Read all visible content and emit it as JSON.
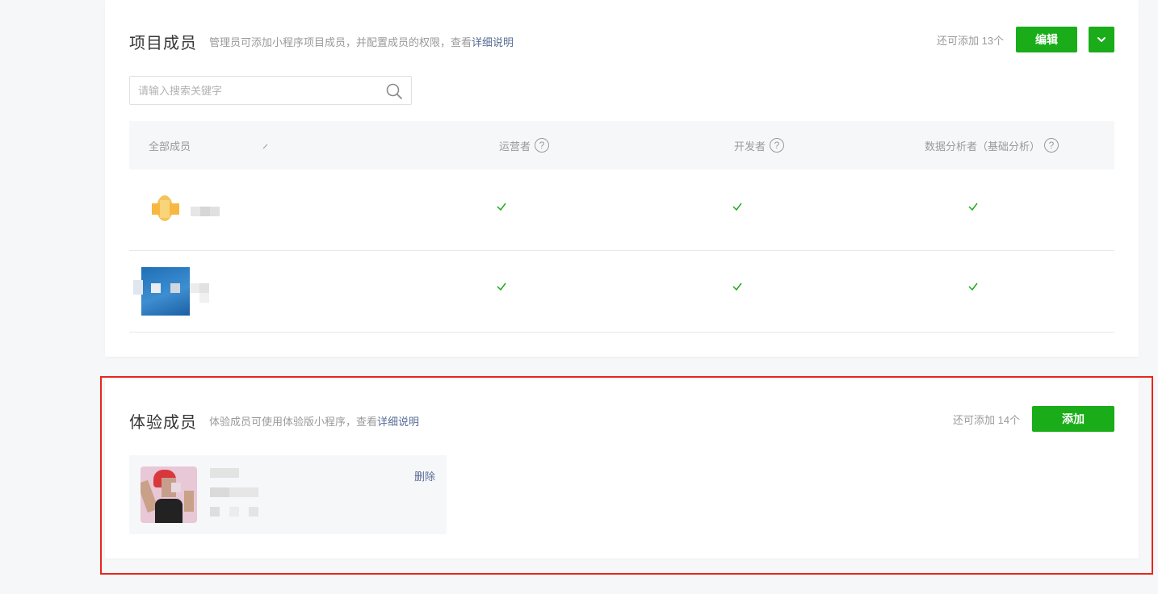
{
  "project_members": {
    "title": "项目成员",
    "desc_prefix": "管理员可添加小程序项目成员，并配置成员的权限，查看",
    "desc_link": "详细说明",
    "remaining": "还可添加 13个",
    "edit_label": "编辑",
    "search_placeholder": "请输入搜索关键字",
    "columns": {
      "all": "全部成员",
      "operator": "运营者",
      "developer": "开发者",
      "analyst": "数据分析者（基础分析）",
      "help_glyph": "?"
    },
    "rows": [
      {
        "operator": true,
        "developer": true,
        "analyst": true
      },
      {
        "operator": true,
        "developer": true,
        "analyst": true
      }
    ]
  },
  "trial_members": {
    "title": "体验成员",
    "desc_prefix": "体验成员可使用体验版小程序，查看",
    "desc_link": "详细说明",
    "remaining": "还可添加 14个",
    "add_label": "添加",
    "delete_label": "删除"
  },
  "colors": {
    "accent_green": "#1aad19",
    "link_blue": "#576b95",
    "highlight_red": "#e8261f"
  }
}
